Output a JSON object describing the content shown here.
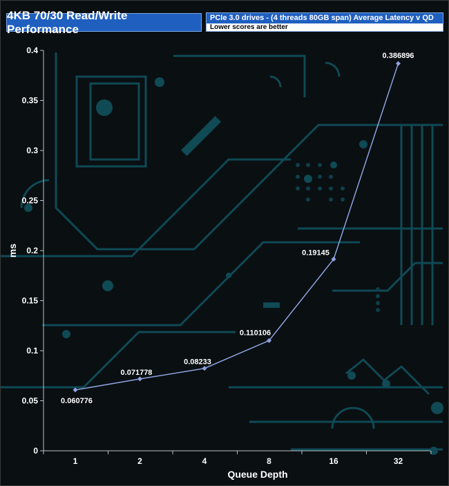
{
  "chart_data": {
    "type": "line",
    "title": "4KB 70/30 Read/Write Performance",
    "subtitle": "PCIe 3.0 drives - (4 threads 80GB span) Average Latency v QD",
    "note": "Lower scores are better",
    "xlabel": "Queue Depth",
    "ylabel": "ms",
    "categories": [
      "1",
      "2",
      "4",
      "8",
      "16",
      "32"
    ],
    "series": [
      {
        "values": [
          0.060776,
          0.071778,
          0.08233,
          0.110106,
          0.19145,
          0.386896
        ]
      }
    ],
    "data_labels": [
      "0.060776",
      "0.071778",
      "0.08233",
      "0.110106",
      "0.19145",
      "0.386896"
    ],
    "ylim": [
      0,
      0.4
    ],
    "yticks": [
      0,
      0.05,
      0.1,
      0.15,
      0.2,
      0.25,
      0.3,
      0.35,
      0.4
    ],
    "ytick_labels": [
      "0",
      "0.05",
      "0.1",
      "0.15",
      "0.2",
      "0.25",
      "0.3",
      "0.35",
      "0.4"
    ],
    "grid": false,
    "line_color": "#8ea2e0",
    "marker_color": "#8ea2e0"
  }
}
